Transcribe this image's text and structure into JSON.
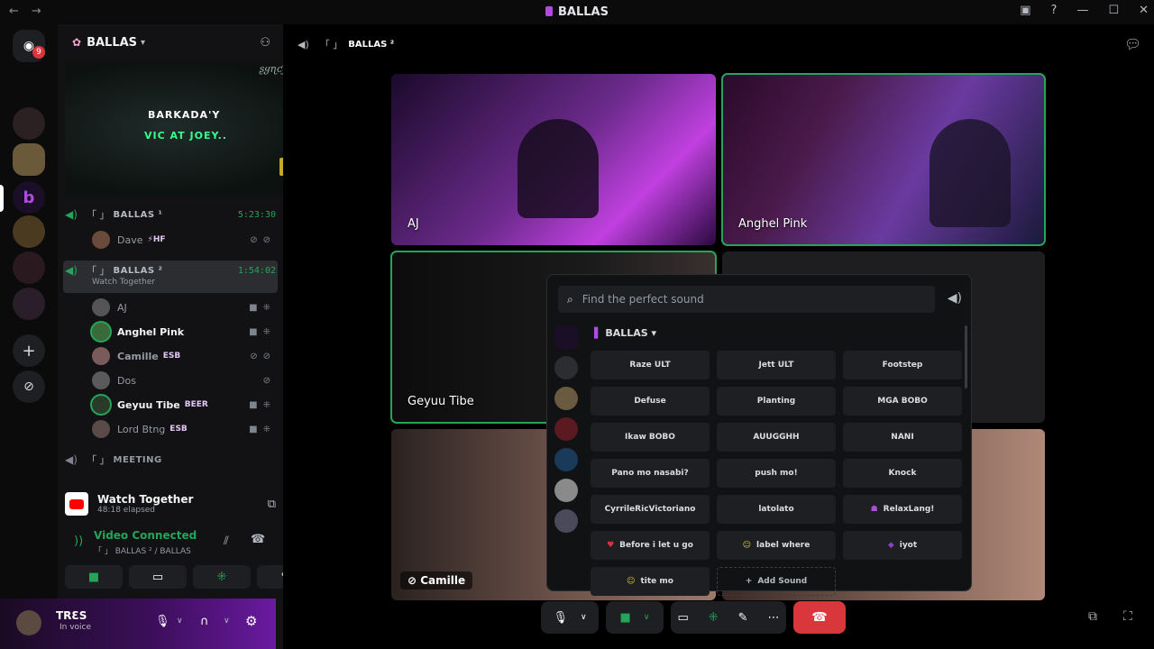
{
  "window": {
    "title": "BALLAS"
  },
  "rail": {
    "badge": "9"
  },
  "guild": {
    "name": "BALLAS"
  },
  "banner": {
    "line1": "BARKADA'Y",
    "line2": "VIC AT JOEY..",
    "signature": "ʂყɳƈϝυɳԃσ"
  },
  "channels": [
    {
      "prefix": "「 」",
      "name": "BALLAS ¹",
      "time": "5:23:30",
      "members": [
        {
          "name": "Dave",
          "tag": "⚡HF",
          "active": false
        }
      ]
    },
    {
      "prefix": "「 」",
      "name": "BALLAS ²",
      "time": "1:54:02",
      "activity": "Watch Together",
      "members": [
        {
          "name": "AJ",
          "tag": "",
          "active": false
        },
        {
          "name": "Anghel Pink",
          "tag": "",
          "active": true
        },
        {
          "name": "Camille",
          "tag": "ESB",
          "active": false
        },
        {
          "name": "Dos",
          "tag": "",
          "active": false
        },
        {
          "name": "Geyuu Tibe",
          "tag": "BEER",
          "active": true
        },
        {
          "name": "Lord Btng",
          "tag": "ESB",
          "active": false
        }
      ]
    },
    {
      "prefix": "「 」",
      "name": "MEETING"
    }
  ],
  "watch_together": {
    "title": "Watch Together",
    "elapsed": "48:18 elapsed"
  },
  "voice": {
    "status": "Video Connected",
    "location": "「 」 BALLAS ² / BALLAS"
  },
  "user": {
    "name": "TRƐS",
    "status": "In voice"
  },
  "header": {
    "channel": "BALLAS ²"
  },
  "tiles": [
    {
      "name": "AJ"
    },
    {
      "name": "Anghel Pink"
    },
    {
      "name": "Geyuu Tibe"
    },
    {
      "name": "Camille"
    }
  ],
  "soundboard": {
    "placeholder": "Find the perfect sound",
    "category": "BALLAS",
    "sounds": [
      "Raze ULT",
      "Jett ULT",
      "Footstep",
      "Defuse",
      "Planting",
      "MGA BOBO",
      "Ikaw BOBO",
      "AUUGGHH",
      "NANI",
      "Pano mo nasabi?",
      "push mo!",
      "Knock",
      "CyrrileRicVictoriano",
      "latolato",
      "RelaxLang!",
      "Before i let u go",
      "label where",
      "iyot",
      "tite mo"
    ],
    "add_label": "Add Sound"
  },
  "colors": {
    "accent": "#23a55a",
    "danger": "#da373c",
    "brand": "#5865f2"
  }
}
